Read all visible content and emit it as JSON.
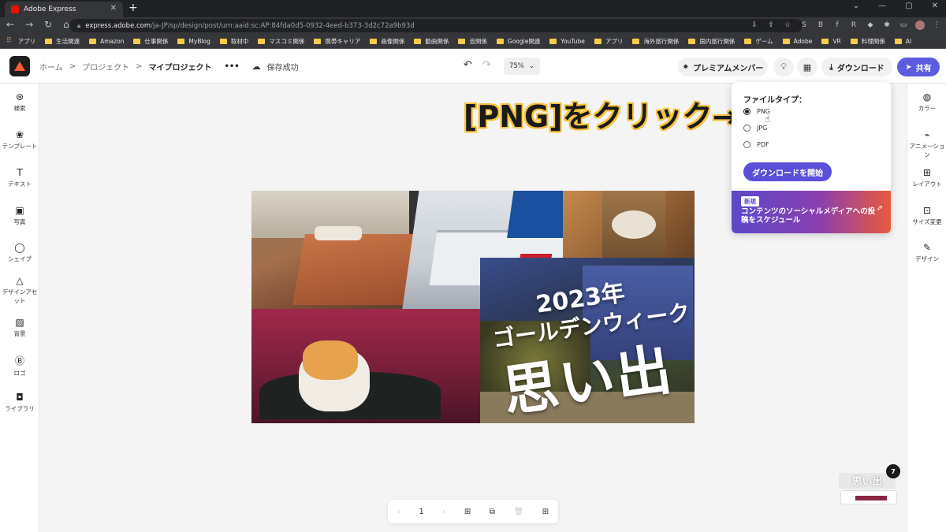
{
  "browser": {
    "tab_title": "Adobe Express",
    "tab_close": "✕",
    "new_tab": "+",
    "window_controls": [
      "⌄",
      "—",
      "▢",
      "✕"
    ],
    "nav": [
      "←",
      "→",
      "↻",
      "⌂"
    ],
    "url_host": "express.adobe.com",
    "url_path": "/ja-JP/sp/design/post/urn:aaid:sc:AP:84fda0d5-0932-4eed-b373-3d2c72a9b93d",
    "extensions": [
      "⇩",
      "⇪",
      "☆",
      "S",
      "B",
      "f",
      "R",
      "◆",
      "✱",
      "▭",
      "",
      "⋮"
    ],
    "bookmarks": [
      "アプリ",
      "生活関連",
      "Amazon",
      "仕事関係",
      "MyBlog",
      "取材中",
      "マスコミ関係",
      "携帯キャリア",
      "画像関係",
      "動画関係",
      "音関係",
      "Google関連",
      "YouTube",
      "アプリ",
      "海外旅行関係",
      "国内旅行関係",
      "ゲーム",
      "Adobe",
      "VR",
      "料理関係",
      "AI"
    ]
  },
  "header": {
    "breadcrumb": [
      "ホーム",
      "プロジェクト"
    ],
    "separator": ">",
    "current": "マイプロジェクト",
    "more": "•••",
    "save_status": "保存成功",
    "zoom": "75%",
    "premium": "プレミアムメンバー",
    "download": "ダウンロード",
    "share": "共有"
  },
  "left_rail": [
    {
      "icon": "search-icon",
      "glyph": "⊛",
      "label": "検索"
    },
    {
      "icon": "templates-icon",
      "glyph": "❀",
      "label": "テンプレート"
    },
    {
      "icon": "text-icon",
      "glyph": "T",
      "label": "テキスト"
    },
    {
      "icon": "photo-icon",
      "glyph": "▣",
      "label": "写真"
    },
    {
      "icon": "shape-icon",
      "glyph": "◯",
      "label": "シェイプ"
    },
    {
      "icon": "design-assets-icon",
      "glyph": "△",
      "label": "デザインアセット"
    },
    {
      "icon": "background-icon",
      "glyph": "▨",
      "label": "背景"
    },
    {
      "icon": "logo-icon",
      "glyph": "Ⓑ",
      "label": "ロゴ"
    },
    {
      "icon": "library-icon",
      "glyph": "◘",
      "label": "ライブラリ"
    }
  ],
  "right_rail": [
    {
      "icon": "color-icon",
      "glyph": "◍",
      "label": "カラー"
    },
    {
      "icon": "animation-icon",
      "glyph": "⌁",
      "label": "アニメーション"
    },
    {
      "icon": "layout-icon",
      "glyph": "⊞",
      "label": "レイアウト"
    },
    {
      "icon": "resize-icon",
      "glyph": "⊡",
      "label": "サイズ変更"
    },
    {
      "icon": "design-icon",
      "glyph": "✎",
      "label": "デザイン"
    }
  ],
  "design": {
    "year": "2023年",
    "subtitle": "ゴールデンウィーク",
    "headline": "思い出"
  },
  "annotation": "[PNG]をクリック→",
  "download_panel": {
    "title": "ファイルタイプ：",
    "options": [
      "PNG",
      "JPG",
      "PDF"
    ],
    "selected": "PNG",
    "start_button": "ダウンロードを開始",
    "promo_badge": "新規",
    "promo_text": "コンテンツのソーシャルメディアへの投稿をスケジュール"
  },
  "pager": {
    "prev": "‹",
    "page": "1",
    "next": "›"
  },
  "thumbnail": {
    "text": "思い出",
    "page_count": "7"
  }
}
